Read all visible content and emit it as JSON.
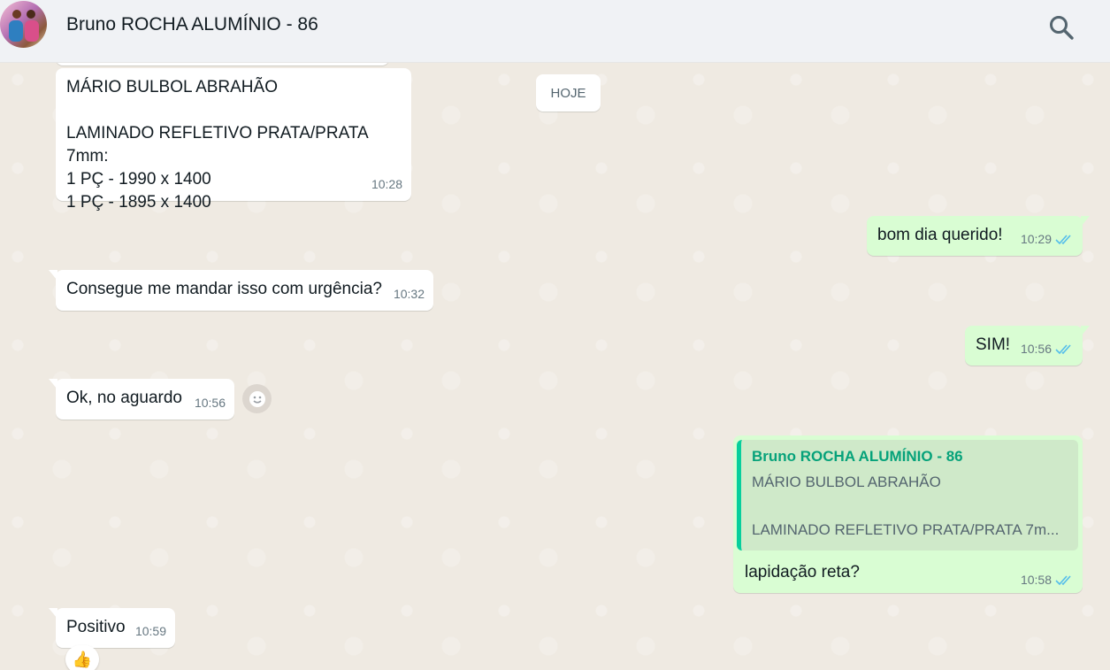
{
  "header": {
    "contact_name": "Bruno ROCHA ALUMÍNIO - 86",
    "avatar_icon": "contact-avatar",
    "search_icon": "search-icon"
  },
  "date_divider": "HOJE",
  "messages": [
    {
      "direction": "in",
      "text": "MÁRIO BULBOL ABRAHÃO\n\nLAMINADO REFLETIVO PRATA/PRATA 7mm:\n1 PÇ - 1990 x 1400\n1 PÇ - 1895 x 1400",
      "time": "10:28"
    },
    {
      "direction": "out",
      "text": "bom dia querido!",
      "time": "10:29",
      "status": "read"
    },
    {
      "direction": "in",
      "text": "Consegue me mandar isso com urgência?",
      "time": "10:32"
    },
    {
      "direction": "out",
      "text": "SIM!",
      "time": "10:56",
      "status": "read"
    },
    {
      "direction": "in",
      "text": "Ok, no aguardo",
      "time": "10:56"
    },
    {
      "direction": "out",
      "quote": {
        "author": "Bruno ROCHA ALUMÍNIO - 86",
        "text": "MÁRIO BULBOL ABRAHÃO\n\nLAMINADO REFLETIVO PRATA/PRATA 7m..."
      },
      "text": "lapidação reta?",
      "time": "10:58",
      "status": "read"
    },
    {
      "direction": "in",
      "text": "Positivo",
      "time": "10:59",
      "reaction": "👍"
    }
  ],
  "colors": {
    "chat_background": "#efeae2",
    "incoming_bubble": "#ffffff",
    "outgoing_bubble": "#d9fdd3",
    "read_ticks": "#53bdeb",
    "quote_accent": "#06cf9c"
  }
}
